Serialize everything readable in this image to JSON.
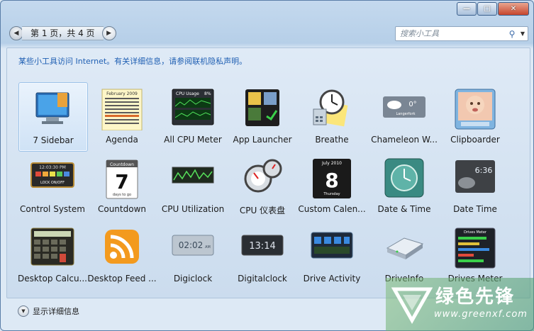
{
  "titlebar": {
    "minimize": "—",
    "maximize": "□",
    "close": "✕"
  },
  "nav": {
    "page_label": "第 1 页，共 4 页",
    "prev_icon": "left-arrow-icon",
    "next_icon": "right-arrow-icon"
  },
  "search": {
    "placeholder": "搜索小工具",
    "icon": "search-icon"
  },
  "info_text": "某些小工具访问 Internet。有关详细信息，请参阅联机隐私声明。",
  "gadgets": [
    {
      "name": "7 Sidebar",
      "selected": true
    },
    {
      "name": "Agenda"
    },
    {
      "name": "All CPU Meter"
    },
    {
      "name": "App Launcher"
    },
    {
      "name": "Breathe"
    },
    {
      "name": "Chameleon W..."
    },
    {
      "name": "Clipboarder"
    },
    {
      "name": "Control System"
    },
    {
      "name": "Countdown"
    },
    {
      "name": "CPU Utilization"
    },
    {
      "name": "CPU 仪表盘"
    },
    {
      "name": "Custom Calen..."
    },
    {
      "name": "Date & Time"
    },
    {
      "name": "Date Time"
    },
    {
      "name": "Desktop Calcu..."
    },
    {
      "name": "Desktop Feed ..."
    },
    {
      "name": "Digiclock"
    },
    {
      "name": "Digitalclock"
    },
    {
      "name": "Drive Activity"
    },
    {
      "name": "DriveInfo"
    },
    {
      "name": "Drives Meter"
    }
  ],
  "thumb_text": {
    "agenda_month": "February 2009",
    "cpu_title": "CPU Usage",
    "cpu_pct": "8%",
    "countdown_label": "Countdown",
    "countdown_days": "7",
    "countdown_sub": "days to go",
    "calendar_month": "July 2010",
    "calendar_day": "8",
    "calendar_weekday": "Thursday",
    "control_time": "12:03:30 PM",
    "control_lock": "LOCK ON/OFF",
    "weather_temp": "0°",
    "weather_city": "Langerfork",
    "datetime_digits": "6:36",
    "digiclock_time": "02:02",
    "digiclock_ampm": "AM",
    "digitalclock_time": "13:14",
    "drivesmeter_title": "Drives Meter"
  },
  "details": {
    "label": "显示详细信息"
  },
  "watermark": {
    "text": "绿色先锋",
    "url": "www.greenxf.com"
  }
}
